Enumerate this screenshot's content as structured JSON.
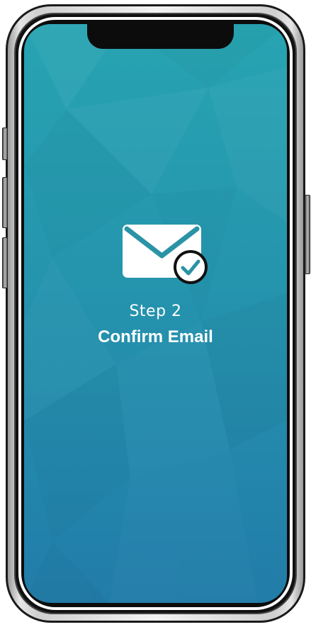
{
  "onboarding": {
    "step_label": "Step 2",
    "step_title": "Confirm Email"
  },
  "icons": {
    "main": "envelope-icon",
    "badge": "checkmark-icon"
  },
  "colors": {
    "screen_top": "#27a4b2",
    "screen_bottom": "#227ca8",
    "accent": "#2a93a6",
    "text": "#ffffff"
  }
}
